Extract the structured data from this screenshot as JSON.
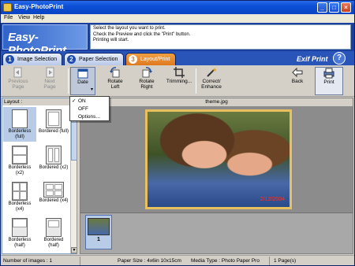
{
  "window": {
    "title": "Easy-PhotoPrint",
    "buttons": [
      "_",
      "□",
      "×"
    ]
  },
  "menu": [
    "File",
    "View",
    "Help"
  ],
  "header": {
    "logo": "Easy-PhotoPrint",
    "message": [
      "Select the layout you want to print.",
      "Check the Preview and click the \"Print\" button.",
      "Printing will start."
    ]
  },
  "tabs": [
    {
      "num": "1",
      "label": "Image Selection",
      "active": false
    },
    {
      "num": "2",
      "label": "Paper Selection",
      "active": false
    },
    {
      "num": "3",
      "label": "Layout/Print",
      "active": true
    }
  ],
  "brand": "Exif Print",
  "help_label": "?",
  "toolbar": {
    "previous": [
      "Previous",
      "Page"
    ],
    "next": [
      "Next",
      "Page"
    ],
    "date": "Date",
    "rotate_left": [
      "Rotate",
      "Left"
    ],
    "rotate_right": [
      "Rotate",
      "Right"
    ],
    "trimming": "Trimming...",
    "correct": [
      "Correct/",
      "Enhance"
    ],
    "back": "Back",
    "print": "Print"
  },
  "date_menu": {
    "check": "✓",
    "items": [
      "ON",
      "OFF",
      "Options..."
    ]
  },
  "layout_panel": {
    "title": "Layout :",
    "items": [
      [
        "Borderless",
        "(full)"
      ],
      [
        "Bordered (full)",
        ""
      ],
      [
        "Borderless",
        "(x2)"
      ],
      [
        "Bordered (x2)",
        ""
      ],
      [
        "Borderless",
        "(x4)"
      ],
      [
        "Bordered (x4)",
        ""
      ],
      [
        "Borderless",
        "(half)"
      ],
      [
        "Bordered",
        "(half)"
      ]
    ]
  },
  "preview": {
    "filename": "theme.jpg",
    "date_stamp": "2/12/2004",
    "thumb_number": "1"
  },
  "status": {
    "count": "Number of images : 1",
    "paper": "Paper Size : 4x6in 10x15cm",
    "media": "Media Type : Photo Paper Pro",
    "pages": "1 Page(s)"
  },
  "colors": {
    "accent_tab": "#e07820",
    "header": "#1a3f9e",
    "title_bar": "#0b4fd6"
  }
}
